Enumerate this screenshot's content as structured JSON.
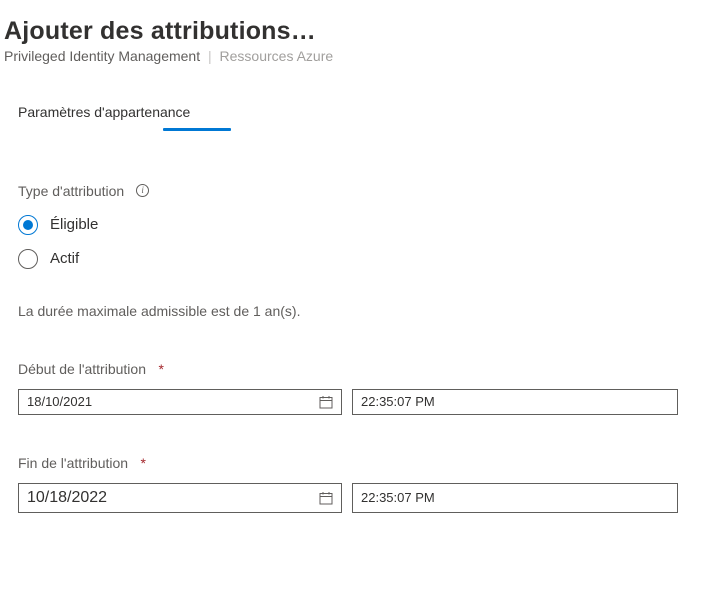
{
  "header": {
    "title": "Ajouter des attributions…",
    "breadcrumb_primary": "Privileged Identity Management",
    "breadcrumb_secondary": "Ressources Azure"
  },
  "tab": {
    "label": "Paramètres d'appartenance"
  },
  "attribution_type": {
    "label": "Type d'attribution",
    "options": {
      "eligible": "Éligible",
      "active": "Actif"
    }
  },
  "hint": "La durée maximale admissible est de 1 an(s).",
  "start": {
    "label": "Début de l'attribution",
    "date": "18/10/2021",
    "time": "22:35:07 PM"
  },
  "end": {
    "label": "Fin de l'attribution",
    "date": "10/18/2022",
    "time": "22:35:07 PM"
  }
}
